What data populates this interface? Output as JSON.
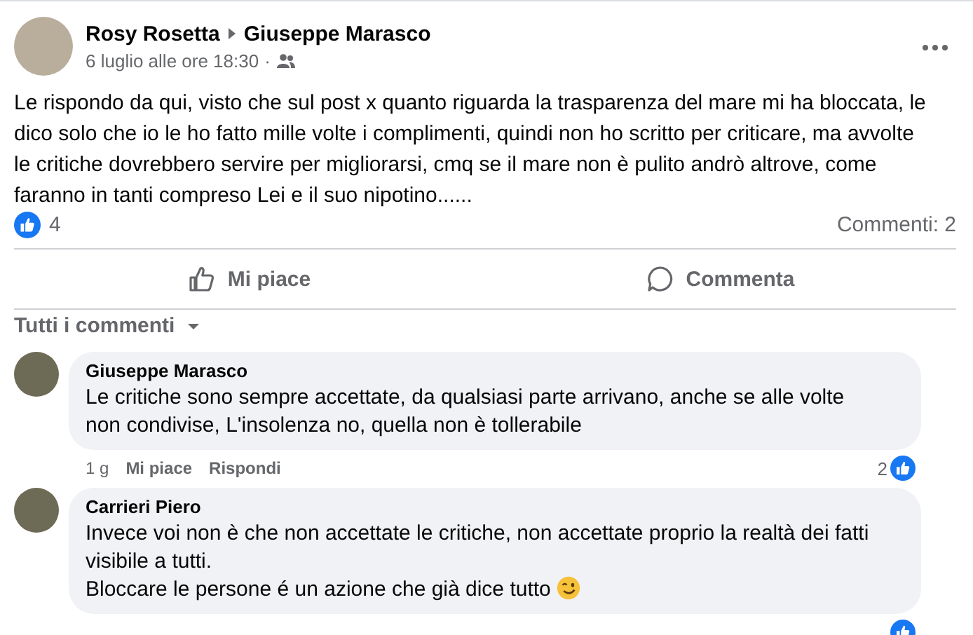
{
  "post": {
    "author": "Rosy Rosetta",
    "recipient": "Giuseppe Marasco",
    "time": "6 luglio alle ore 18:30",
    "separator": "·",
    "text": "Le rispondo da qui, visto che sul post x quanto riguarda la trasparenza del mare mi ha bloccata, le\ndico solo che io le ho fatto mille volte i complimenti, quindi non ho scritto per criticare, ma avvolte\nle critiche dovrebbero servire per migliorarsi, cmq se il mare non è pulito andrò altrove, come\nfaranno in tanti compreso Lei e il suo nipotino......",
    "likes": "4",
    "comments_count": "Commenti: 2"
  },
  "actions": [
    {
      "kind": "like",
      "label": "Mi piace"
    },
    {
      "kind": "comment",
      "label": "Commenta"
    }
  ],
  "comments_filter": "Tutti i commenti",
  "comments": [
    {
      "author": "Giuseppe Marasco",
      "text": "Le critiche sono sempre accettate, da qualsiasi parte arrivano, anche se alle volte\nnon condivise, L'insolenza no, quella non è tollerabile",
      "time": "1 g",
      "like": "Mi piace",
      "reply": "Rispondi",
      "likes": "2"
    },
    {
      "author": "Carrieri Piero",
      "text": "Invece voi non è che non accettate le critiche, non accettate proprio la realtà dei fatti\nvisibile a tutti.\nBloccare le persone é un azione che già dice tutto",
      "wink_emoji": true
    }
  ]
}
